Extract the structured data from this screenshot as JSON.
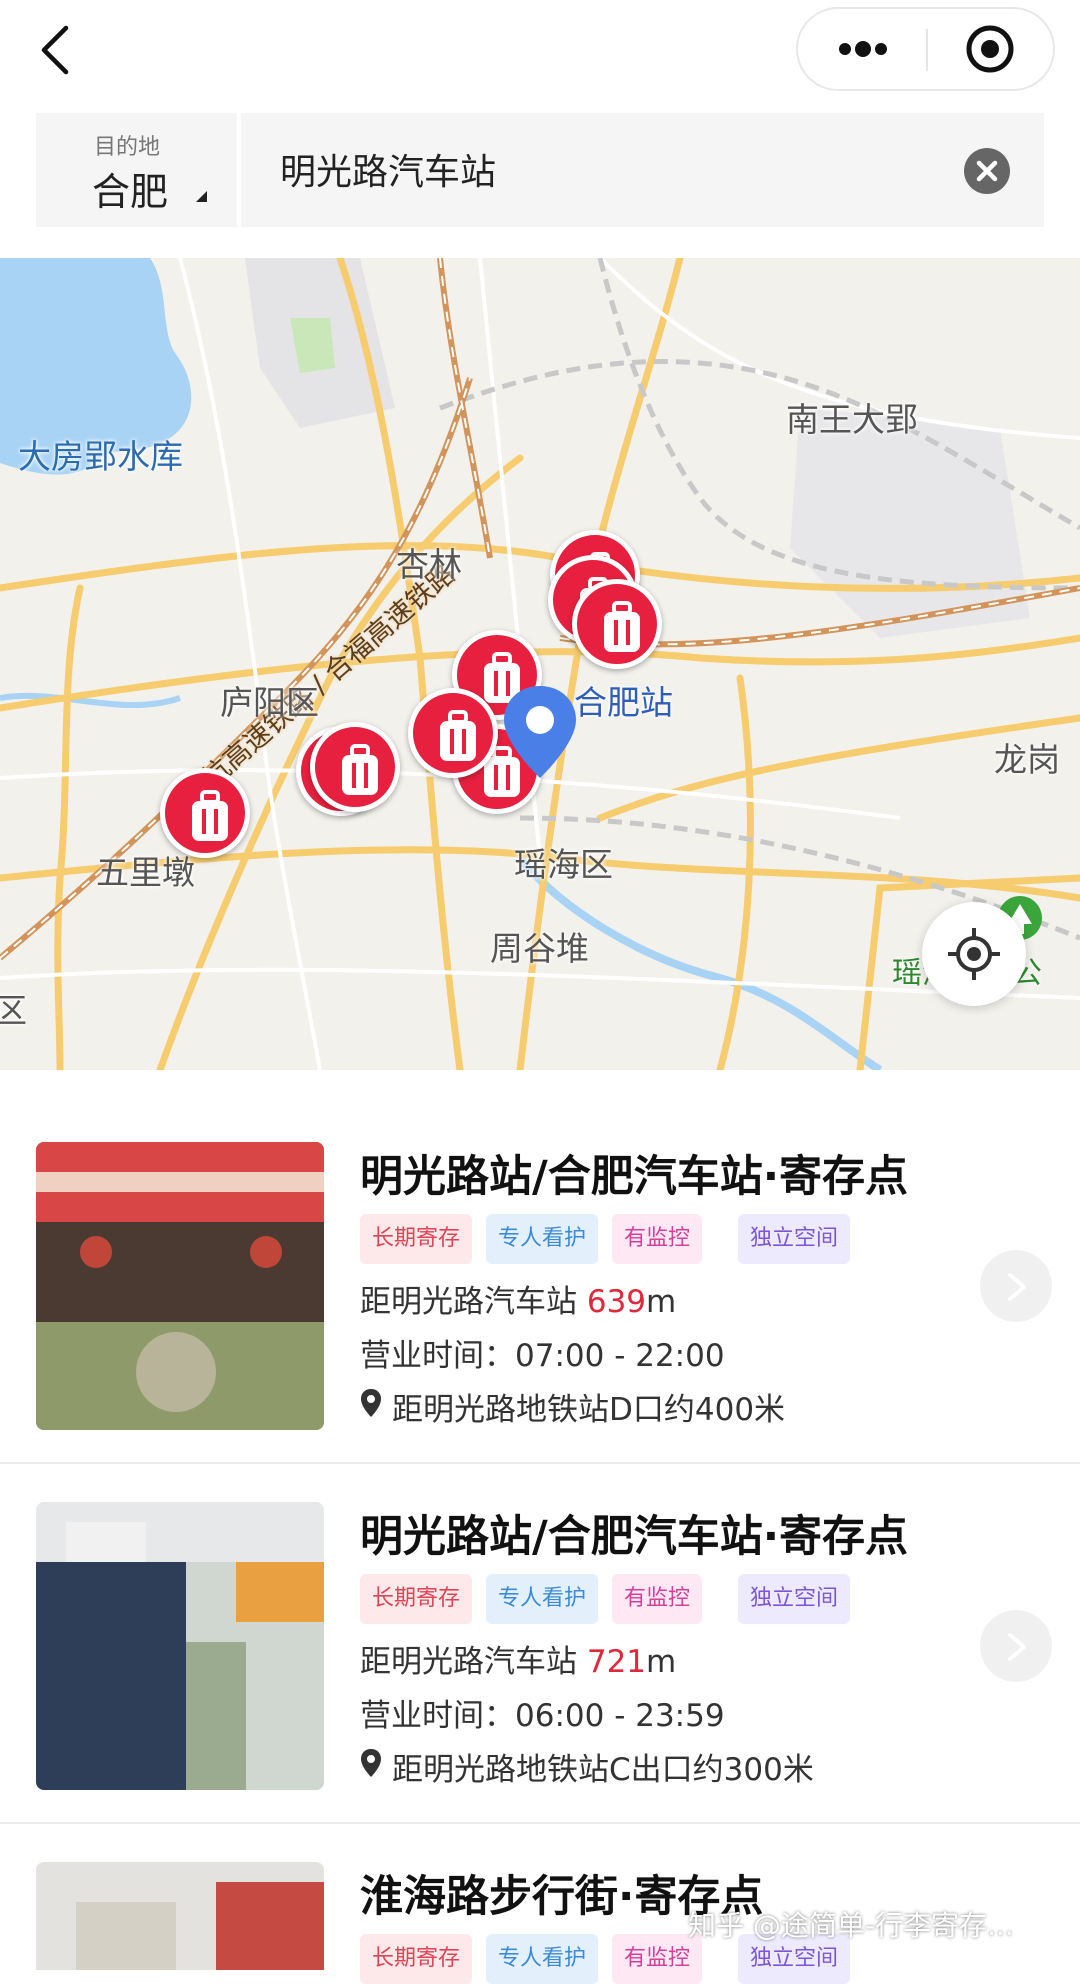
{
  "search": {
    "city_label": "目的地",
    "city_value": "合肥",
    "query": "明光路汽车站"
  },
  "map": {
    "labels": {
      "reservoir": "大房郢水库",
      "railway": "商杭高速铁路 / 合福高速铁路",
      "nanwang": "南王大郢",
      "xinglin": "杏林",
      "luyang": "庐阳区",
      "hefei_station": "合肥站",
      "longgang": "龙岗",
      "wulidun": "五里墩",
      "yaohai": "瑶海区",
      "zhougudui": "周谷堆",
      "wetland": "瑶海湿地公",
      "edge": "区"
    },
    "marker_count": 9
  },
  "colors": {
    "accent_red": "#e8203f",
    "pin_blue": "#4a7fe8",
    "distance_red": "#e0283b"
  },
  "list": {
    "cards": [
      {
        "title": "明光路站/合肥汽车站·寄存点",
        "tags": [
          "长期寄存",
          "专人看护",
          "有监控",
          "独立空间"
        ],
        "distance_prefix": "距明光路汽车站 ",
        "distance_value": "639",
        "distance_unit": "m",
        "hours": "营业时间：07:00 - 22:00",
        "address": "距明光路地铁站D口约400米"
      },
      {
        "title": "明光路站/合肥汽车站·寄存点",
        "tags": [
          "长期寄存",
          "专人看护",
          "有监控",
          "独立空间"
        ],
        "distance_prefix": "距明光路汽车站 ",
        "distance_value": "721",
        "distance_unit": "m",
        "hours": "营业时间：06:00 - 23:59",
        "address": "距明光路地铁站C出口约300米"
      },
      {
        "title": "淮海路步行街·寄存点",
        "tags": [
          "长期寄存",
          "专人看护",
          "有监控",
          "独立空间"
        ]
      }
    ]
  },
  "watermark": "知乎 @途简单-行李寄存..."
}
